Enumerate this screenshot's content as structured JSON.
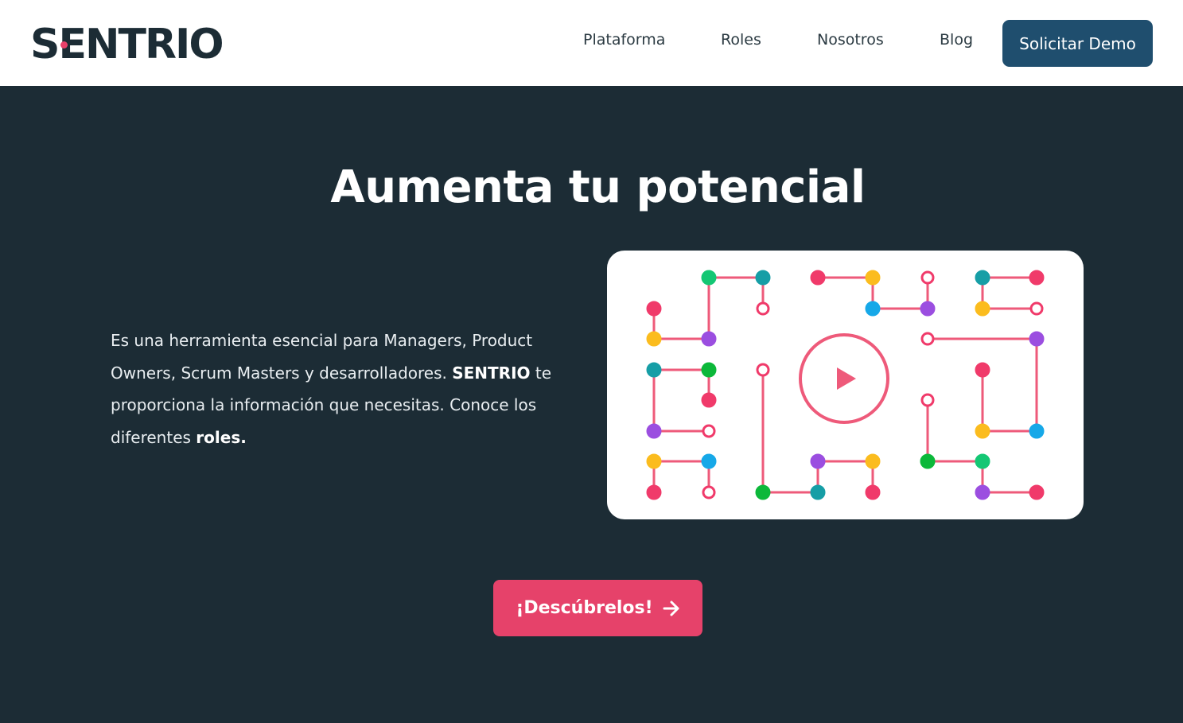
{
  "header": {
    "logo_text": "SENTRIO",
    "nav": [
      {
        "label": "Plataforma"
      },
      {
        "label": "Roles"
      },
      {
        "label": "Nosotros"
      },
      {
        "label": "Blog"
      }
    ],
    "demo_button": "Solicitar Demo"
  },
  "hero": {
    "title": "Aumenta tu potencial",
    "text_1": "Es una herramienta esencial para Managers, Product Owners, Scrum Masters y desarrolladores. ",
    "text_brand": "SENTRIO",
    "text_2": " te proporciona la información que necesitas. Conoce los diferentes ",
    "text_roles": "roles.",
    "cta_label": "¡Descúbrelos!"
  },
  "video": {
    "play_icon": "play-icon"
  },
  "colors": {
    "background": "#1c2c35",
    "brand_blue": "#1f4e6e",
    "accent_pink": "#e6426a",
    "line_pink": "#ee5a7a",
    "dot_red": "#f03a6a",
    "dot_yellow": "#fbbc1e",
    "dot_green": "#14c774",
    "dot_teal": "#169ea6",
    "dot_purple": "#9b4ee0",
    "dot_blue": "#16a8e8",
    "dot_dark_green": "#0cb83a"
  }
}
